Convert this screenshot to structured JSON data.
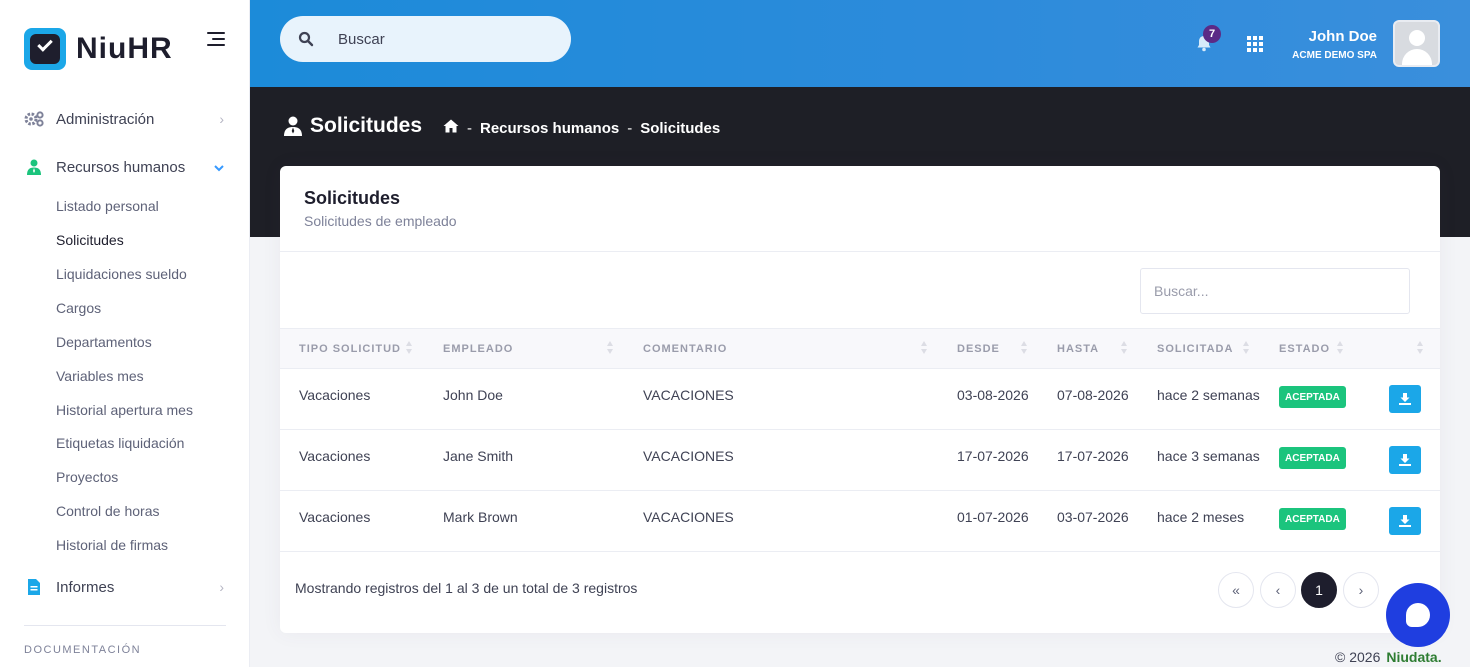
{
  "brand": {
    "name": "NiuHR"
  },
  "sidebar": {
    "items": [
      {
        "label": "Administración"
      },
      {
        "label": "Recursos humanos"
      },
      {
        "label": "Informes"
      }
    ],
    "subitems": [
      {
        "label": "Listado personal"
      },
      {
        "label": "Solicitudes"
      },
      {
        "label": "Liquidaciones sueldo"
      },
      {
        "label": "Cargos"
      },
      {
        "label": "Departamentos"
      },
      {
        "label": "Variables mes"
      },
      {
        "label": "Historial apertura mes"
      },
      {
        "label": "Etiquetas liquidación"
      },
      {
        "label": "Proyectos"
      },
      {
        "label": "Control de horas"
      },
      {
        "label": "Historial de firmas"
      }
    ],
    "section": "DOCUMENTACIÓN"
  },
  "header": {
    "search_placeholder": "Buscar",
    "notifications": "7",
    "user_name": "John Doe",
    "user_company": "ACME DEMO SPA"
  },
  "subheader": {
    "title": "Solicitudes",
    "breadcrumb": [
      "Recursos humanos",
      "Solicitudes"
    ],
    "sep": "-"
  },
  "card": {
    "title": "Solicitudes",
    "subtitle": "Solicitudes de empleado",
    "search_placeholder": "Buscar..."
  },
  "table": {
    "columns": [
      "TIPO SOLICITUD",
      "EMPLEADO",
      "COMENTARIO",
      "DESDE",
      "HASTA",
      "SOLICITADA",
      "ESTADO"
    ],
    "rows": [
      {
        "tipo": "Vacaciones",
        "empleado": "John Doe",
        "comentario": "VACACIONES",
        "desde": "03-08-2026",
        "hasta": "07-08-2026",
        "solicitada": "hace 2 semanas",
        "estado": "ACEPTADA"
      },
      {
        "tipo": "Vacaciones",
        "empleado": "Jane Smith",
        "comentario": "VACACIONES",
        "desde": "17-07-2026",
        "hasta": "17-07-2026",
        "solicitada": "hace 3 semanas",
        "estado": "ACEPTADA"
      },
      {
        "tipo": "Vacaciones",
        "empleado": "Mark Brown",
        "comentario": "VACACIONES",
        "desde": "01-07-2026",
        "hasta": "03-07-2026",
        "solicitada": "hace 2 meses",
        "estado": "ACEPTADA"
      }
    ],
    "info": "Mostrando registros del 1 al 3 de un total de 3 registros",
    "pager": {
      "first": "«",
      "prev": "‹",
      "current": "1",
      "next": "›"
    }
  },
  "footer": {
    "year": "© 2026",
    "brand": "Niudata."
  },
  "colors": {
    "accent": "#1ba7e8",
    "success": "#1bc47d",
    "dark": "#1e1f26",
    "chat": "#1f3ee0"
  },
  "icons": [
    "search-icon",
    "bell-icon",
    "apps-grid-icon",
    "home-icon",
    "user-tie-icon",
    "cogs-icon",
    "download-icon",
    "chat-icon"
  ]
}
